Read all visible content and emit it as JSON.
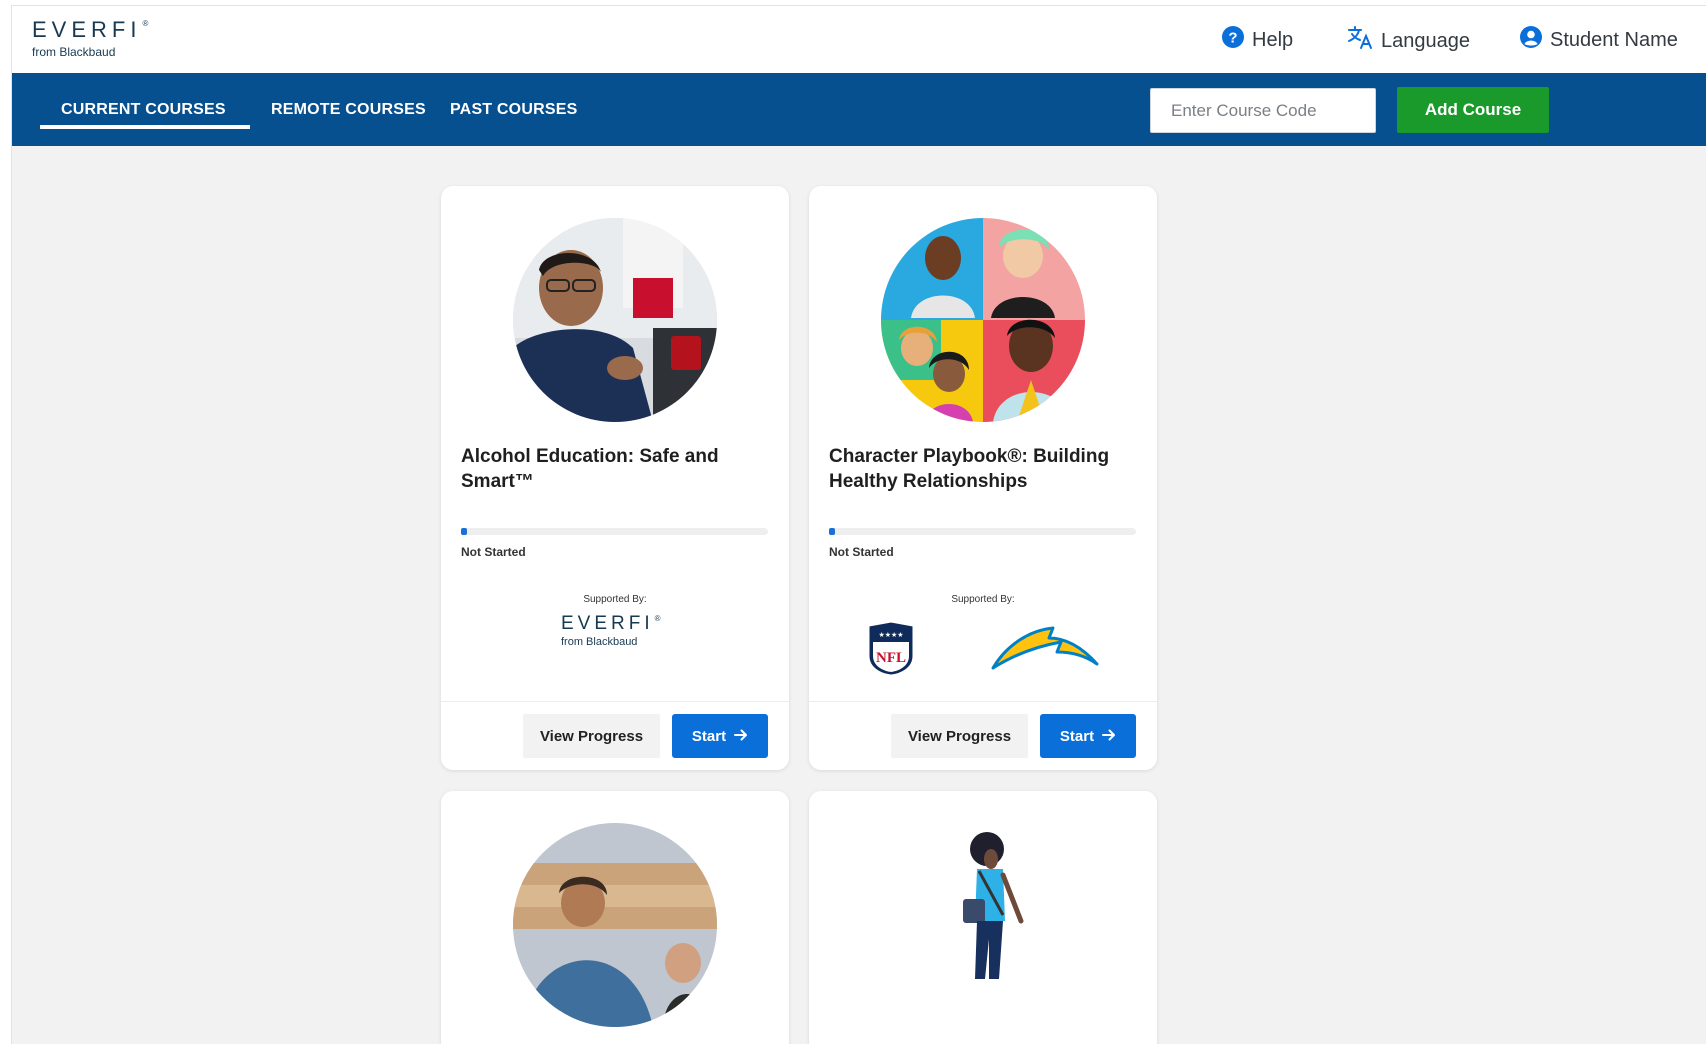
{
  "header": {
    "logo_text": "EVERFI",
    "logo_sub": "from Blackbaud",
    "help_label": "Help",
    "language_label": "Language",
    "user_label": "Student Name"
  },
  "nav": {
    "tabs": [
      {
        "label": "CURRENT COURSES",
        "active": true
      },
      {
        "label": "REMOTE COURSES",
        "active": false
      },
      {
        "label": "PAST COURSES",
        "active": false
      }
    ],
    "course_code_placeholder": "Enter Course Code",
    "add_course_label": "Add Course"
  },
  "courses": [
    {
      "title": "Alcohol Education: Safe and Smart™",
      "status": "Not Started",
      "progress": 0.02,
      "supported_by_label": "Supported By:",
      "sponsor": "EVERFI",
      "sponsor_sub": "from Blackbaud",
      "view_progress_label": "View Progress",
      "start_label": "Start"
    },
    {
      "title": "Character Playbook®: Building Healthy Relationships",
      "status": "Not Started",
      "progress": 0.02,
      "supported_by_label": "Supported By:",
      "sponsor": "NFL",
      "view_progress_label": "View Progress",
      "start_label": "Start"
    }
  ],
  "colors": {
    "nav_bg": "#06508f",
    "add_course_bg": "#1a9a2a",
    "start_bg": "#0b6fd9",
    "progress_fill": "#1a6fd8",
    "page_bg": "#f2f2f2"
  },
  "icons": {
    "help": "question-circle-icon",
    "language": "translate-icon",
    "user": "user-circle-icon",
    "start_arrow": "arrow-right-icon"
  }
}
